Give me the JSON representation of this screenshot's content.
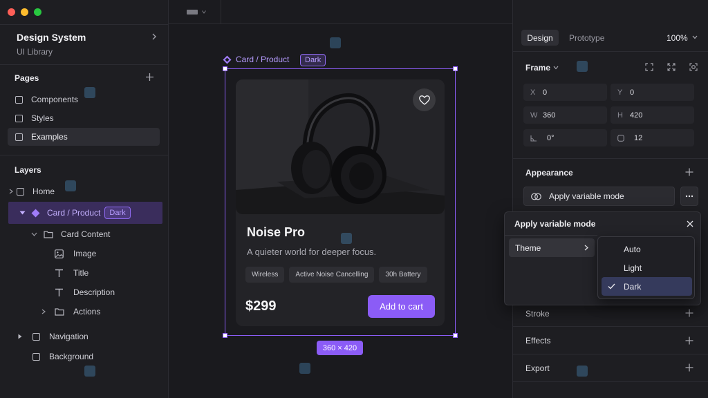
{
  "window": {
    "file_title": "Design System",
    "file_subtitle": "UI Library"
  },
  "pages": {
    "title": "Pages",
    "items": [
      {
        "label": "Components"
      },
      {
        "label": "Styles"
      },
      {
        "label": "Examples",
        "active": true
      }
    ]
  },
  "layers": {
    "title": "Layers",
    "home": "Home",
    "card_product": "Card / Product",
    "card_badge": "Dark",
    "card_content": "Card Content",
    "image": "Image",
    "title_layer": "Title",
    "description": "Description",
    "actions": "Actions",
    "navigation": "Navigation",
    "background": "Background"
  },
  "canvas": {
    "frame_label": "Card / Product",
    "frame_badge": "Dark",
    "size_badge": "360 × 420",
    "card": {
      "name": "Noise Pro",
      "description": "A quieter world for deeper focus.",
      "tags": [
        "Wireless",
        "Active Noise Cancelling",
        "30h Battery"
      ],
      "price": "$299",
      "cta": "Add to cart"
    }
  },
  "panel": {
    "tabs": [
      "Design",
      "Prototype"
    ],
    "zoom": "100%",
    "frame_title": "Frame",
    "fields": {
      "x_label": "X",
      "x_value": "0",
      "y_label": "Y",
      "y_value": "0",
      "w_label": "W",
      "w_value": "360",
      "h_label": "H",
      "h_value": "420",
      "rotation_value": "0°",
      "radius_value": "12"
    },
    "appearance_title": "Appearance",
    "apply_label": "Apply variable mode",
    "popover": {
      "title": "Apply variable mode",
      "theme_label": "Theme",
      "options": [
        "Auto",
        "Light",
        "Dark"
      ],
      "selected": "Dark"
    },
    "stroke_title": "Stroke",
    "effects_title": "Effects",
    "export_title": "Export"
  },
  "colors": {
    "accent": "#8b5cf6",
    "panel_bg": "#1e1e22",
    "canvas_bg": "#1a1a1e"
  }
}
